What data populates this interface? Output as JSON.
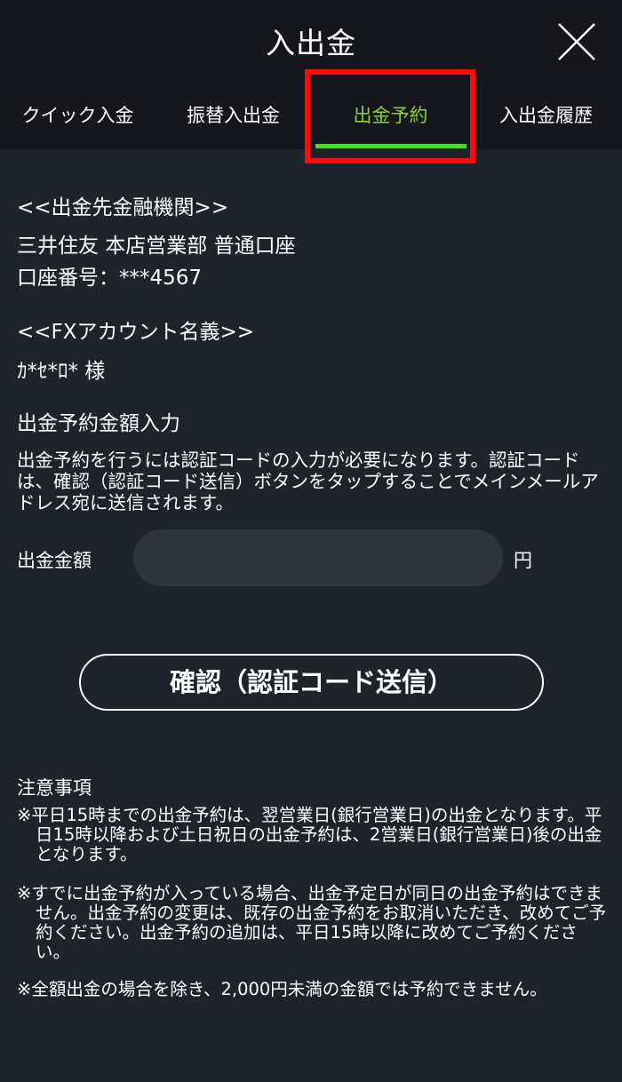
{
  "header": {
    "title": "入出金",
    "close_icon": "close-icon"
  },
  "tabs": [
    {
      "label": "クイック入金",
      "active": false
    },
    {
      "label": "振替入出金",
      "active": false
    },
    {
      "label": "出金予約",
      "active": true
    },
    {
      "label": "入出金履歴",
      "active": false
    }
  ],
  "colors": {
    "background": "#1f232c",
    "header": "#15171c",
    "active_tab": "#8fce3a",
    "tab_underline": "#4fd62a",
    "highlight": "#ff0a0a",
    "input_bg": "#2f333d"
  },
  "bank": {
    "heading": "<<出金先金融機関>>",
    "branch": "三井住友 本店営業部 普通口座",
    "account": "口座番号：***4567"
  },
  "fx_account": {
    "heading": "<<FXアカウント名義>>",
    "name": "ｶ*ｾ*ﾛ* 様"
  },
  "form": {
    "section_title": "出金予約金額入力",
    "description": "出金予約を行うには認証コードの入力が必要になります。認証コードは、確認（認証コード送信）ボタンをタップすることでメインメールアドレス宛に送信されます。",
    "amount_label": "出金金額",
    "amount_value": "",
    "unit": "円",
    "confirm_label": "確認（認証コード送信）"
  },
  "notes": {
    "title": "注意事項",
    "items": [
      "※平日15時までの出金予約は、翌営業日(銀行営業日)の出金となります。平日15時以降および土日祝日の出金予約は、2営業日(銀行営業日)後の出金となります。",
      "※すでに出金予約が入っている場合、出金予定日が同日の出金予約はできません。出金予約の変更は、既存の出金予約をお取消いただき、改めてご予約ください。出金予約の追加は、平日15時以降に改めてご予約ください。",
      "※全額出金の場合を除き、2,000円未満の金額では予約できません。"
    ]
  }
}
